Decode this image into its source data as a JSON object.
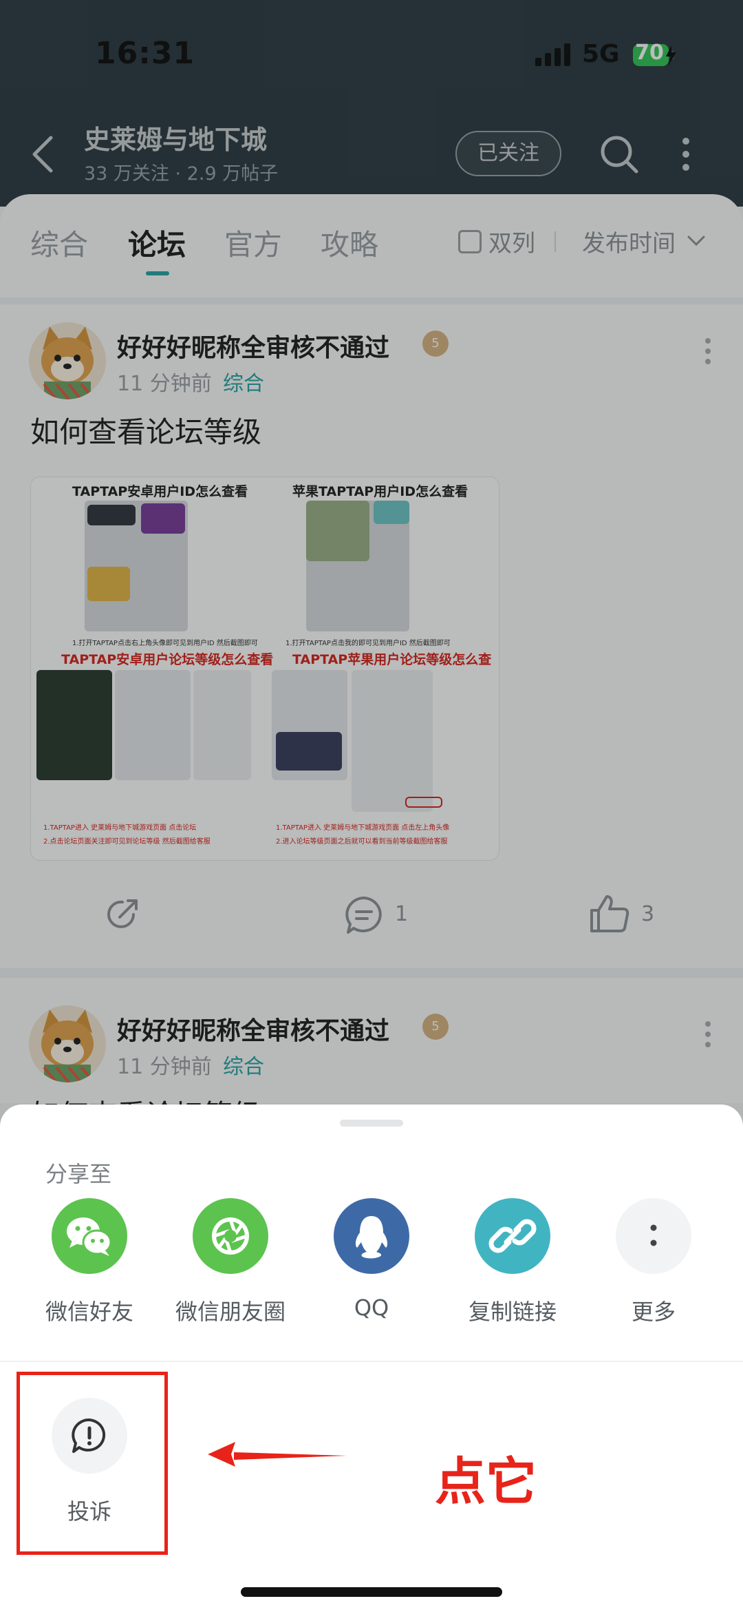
{
  "status": {
    "time": "16:31",
    "network": "5G",
    "battery": "70"
  },
  "header": {
    "title": "史莱姆与地下城",
    "subtitle": "33 万关注 · 2.9 万帖子",
    "follow_label": "已关注"
  },
  "tabs": [
    {
      "label": "综合",
      "active": false
    },
    {
      "label": "论坛",
      "active": true
    },
    {
      "label": "官方",
      "active": false
    },
    {
      "label": "攻略",
      "active": false
    }
  ],
  "filters": {
    "dual_column": "双列",
    "dual_checked": false,
    "sort": "发布时间"
  },
  "posts": [
    {
      "author": "好好好昵称全审核不通过",
      "level": "5",
      "time": "11 分钟前",
      "category": "综合",
      "title": "如何查看论坛等级",
      "image": {
        "left_heading": "TAPTAP安卓用户ID怎么查看",
        "right_heading": "苹果TAPTAP用户ID怎么查看",
        "left_caption": "1.打开TAPTAP点击右上角头像即可见到用户ID 然后截图即可",
        "right_caption": "1.打开TAPTAP点击我的即可见到用户ID 然后截图即可",
        "left_red_heading": "TAPTAP安卓用户论坛等级怎么查看",
        "right_red_heading": "TAPTAP苹果用户论坛等级怎么查看",
        "left_step1": "1.TAPTAP进入 史莱姆与地下城游戏页面 点击论坛",
        "left_step2": "2.点击论坛页面关注即可见到论坛等级 然后截图给客服",
        "right_step1": "1.TAPTAP进入 史莱姆与地下城游戏页面 点击左上角头像",
        "right_step2": "2.进入论坛等级页面之后就可以看到当前等级截图给客服"
      },
      "comments": "1",
      "likes": "3"
    },
    {
      "author": "好好好昵称全审核不通过",
      "level": "5",
      "time": "11 分钟前",
      "category": "综合",
      "title": "如何查看论坛等级"
    }
  ],
  "share_sheet": {
    "title": "分享至",
    "items": [
      {
        "label": "微信好友",
        "icon": "wechat-icon",
        "color": "#5cc34f"
      },
      {
        "label": "微信朋友圈",
        "icon": "moments-icon",
        "color": "#5cc34f"
      },
      {
        "label": "QQ",
        "icon": "qq-icon",
        "color": "#3d6aa6"
      },
      {
        "label": "复制链接",
        "icon": "link-icon",
        "color": "#41b4c2"
      },
      {
        "label": "更多",
        "icon": "more-dots-icon",
        "color": "#f2f3f4"
      }
    ],
    "report_label": "投诉",
    "annotation": "点它"
  }
}
